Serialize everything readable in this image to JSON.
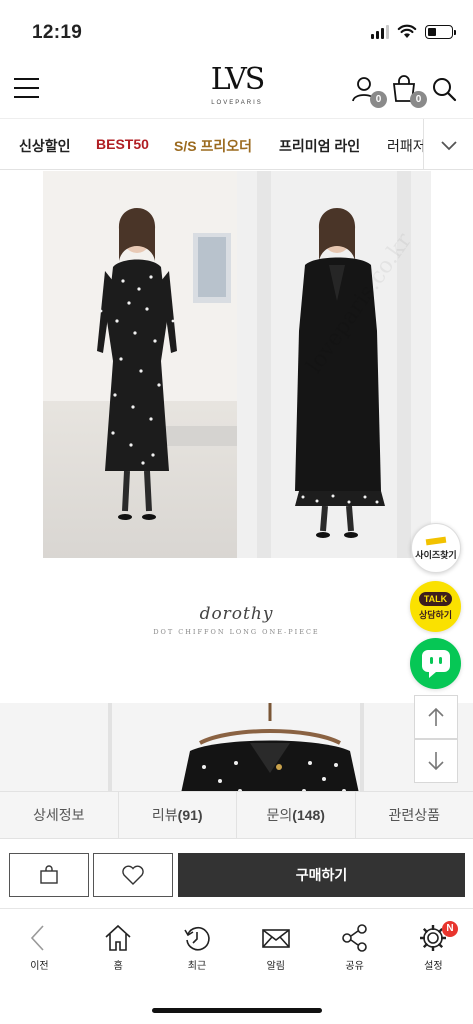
{
  "status_bar": {
    "time": "12:19",
    "battery_level": 0.35
  },
  "header": {
    "logo_mark": "LVS",
    "logo_text": "LOVEPARIS",
    "user_badge": "0",
    "cart_badge": "0"
  },
  "category_nav": {
    "items": [
      {
        "label": "신상할인",
        "color": "#222222"
      },
      {
        "label": "BEST50",
        "color": "#b01e23"
      },
      {
        "label": "S/S 프리오더",
        "color": "#9b6a1f"
      },
      {
        "label": "프리미엄 라인",
        "color": "#222222"
      },
      {
        "label": "러패저",
        "color": "#222222"
      }
    ]
  },
  "product": {
    "script_name": "dorothy",
    "script_sub": "DOT CHIFFON LONG ONE-PIECE",
    "watermark": "loveparis.co.kr"
  },
  "floating": {
    "size_label": "사이즈찾기",
    "talk_bubble": "TALK",
    "talk_label": "상담하기"
  },
  "detail_tabs": [
    {
      "label": "상세정보",
      "count": ""
    },
    {
      "label": "리뷰",
      "count": "(91)"
    },
    {
      "label": "문의",
      "count": "(148)"
    },
    {
      "label": "관련상품",
      "count": ""
    }
  ],
  "buy_bar": {
    "buy_label": "구매하기"
  },
  "toolbar": {
    "items": [
      {
        "label": "이전",
        "icon": "back-icon"
      },
      {
        "label": "홈",
        "icon": "home-icon"
      },
      {
        "label": "최근",
        "icon": "recent-icon"
      },
      {
        "label": "알림",
        "icon": "mail-icon"
      },
      {
        "label": "공유",
        "icon": "share-icon"
      },
      {
        "label": "설정",
        "icon": "gear-icon"
      }
    ],
    "settings_badge": "N"
  },
  "colors": {
    "accent_dark": "#333333",
    "best_red": "#b01e23",
    "preorder_brown": "#9b6a1f",
    "kakao_yellow": "#fae100",
    "line_green": "#06c755"
  }
}
